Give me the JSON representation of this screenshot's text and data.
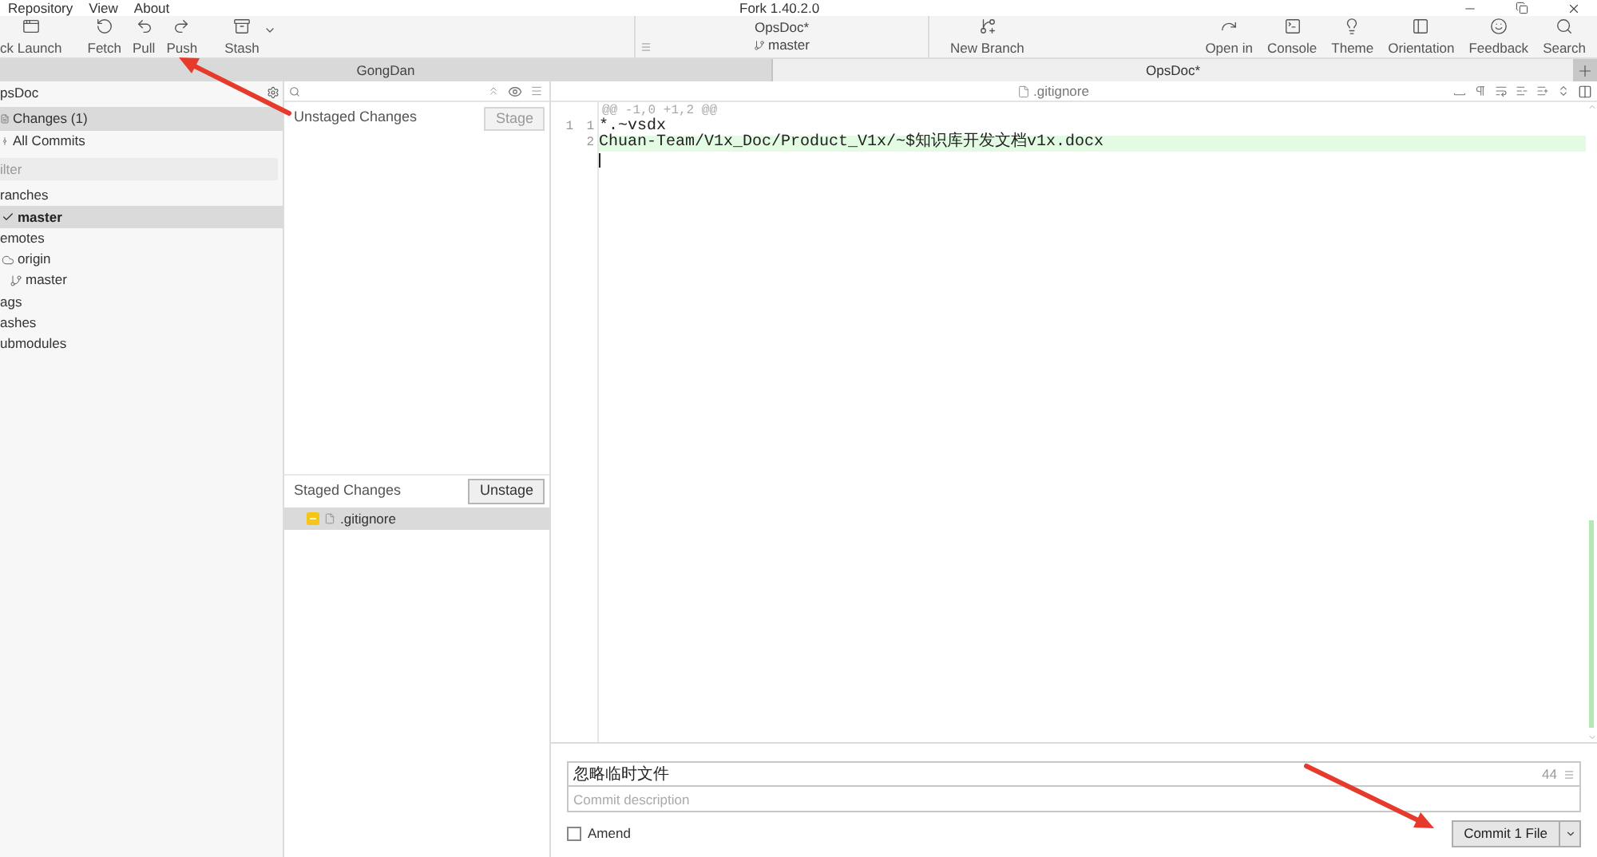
{
  "menu": [
    {
      "label": "Repository"
    },
    {
      "label": "View"
    },
    {
      "label": "About"
    }
  ],
  "window": {
    "title": "Fork 1.40.2.0"
  },
  "toolbar": {
    "left": [
      {
        "label": "ck Launch",
        "kind": "launch",
        "dropdown": false
      },
      {
        "label": "Fetch",
        "kind": "fetch",
        "dropdown": false
      },
      {
        "label": "Pull",
        "kind": "pull",
        "dropdown": false
      },
      {
        "label": "Push",
        "kind": "push",
        "dropdown": false
      },
      {
        "label": "Stash",
        "kind": "stash",
        "dropdown": true
      }
    ],
    "repository": {
      "name": "OpsDoc*",
      "branch": "master"
    },
    "middle": [
      {
        "label": "New Branch",
        "kind": "branch"
      }
    ],
    "right": [
      {
        "label": "Open in",
        "kind": "open"
      },
      {
        "label": "Console",
        "kind": "console"
      },
      {
        "label": "Theme",
        "kind": "theme"
      },
      {
        "label": "Orientation",
        "kind": "orientation"
      },
      {
        "label": "Feedback",
        "kind": "feedback"
      },
      {
        "label": "Search",
        "kind": "search"
      }
    ]
  },
  "tabs": [
    {
      "label": "GongDan",
      "selected": false
    },
    {
      "label": "OpsDoc*",
      "selected": true
    }
  ],
  "sidebar": {
    "title": "psDoc",
    "views": [
      {
        "label": "Changes (1)",
        "kind": "changes",
        "selected": true
      },
      {
        "label": "All Commits",
        "kind": "commits",
        "selected": false
      }
    ],
    "filter": {
      "placeholder": "ilter"
    },
    "tree": [
      {
        "label": "ranches",
        "selected": false,
        "children": [
          {
            "label": "master",
            "kind": "branch",
            "current": true,
            "selected": true
          }
        ]
      },
      {
        "label": "emotes",
        "selected": false,
        "children": [
          {
            "label": "origin",
            "kind": "remote",
            "selected": false,
            "children": [
              {
                "label": "master",
                "kind": "branch",
                "current": false,
                "selected": false
              }
            ]
          }
        ]
      },
      {
        "label": "ags",
        "selected": false
      },
      {
        "label": "ashes",
        "selected": false
      },
      {
        "label": "ubmodules",
        "selected": false
      }
    ]
  },
  "unstaged": {
    "title": "Unstaged Changes",
    "button": {
      "label": "Stage",
      "disabled": true
    }
  },
  "staged": {
    "title": "Staged Changes",
    "button": {
      "label": "Unstage",
      "disabled": false
    },
    "files": [
      {
        "name": ".gitignore",
        "color": "#f5c518",
        "selected": true
      }
    ]
  },
  "diff": {
    "file": ".gitignore",
    "hunk": "@@ -1,0 +1,2 @@",
    "lines": [
      {
        "old": "1",
        "new": "1",
        "text": "*.~vsdx",
        "kind": "context"
      },
      {
        "new": "2",
        "text": "Chuan-Team/V1x_Doc/Product_V1x/~$知识库开发文档v1x.docx",
        "kind": "added"
      }
    ]
  },
  "commit": {
    "summary": "忽略临时文件",
    "remaining": "44",
    "description": {
      "placeholder": "Commit description"
    },
    "amend": {
      "label": "Amend",
      "checked": false
    },
    "button": "Commit 1 File"
  }
}
